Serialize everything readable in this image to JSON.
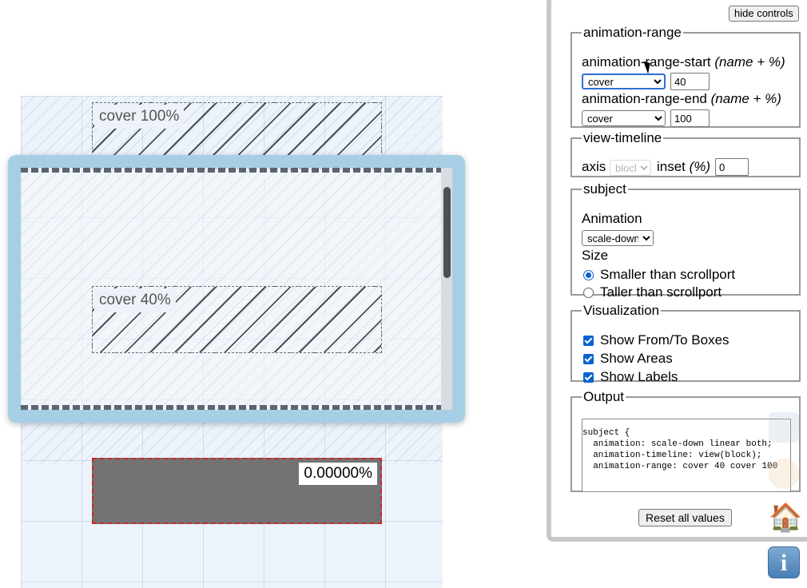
{
  "visualization": {
    "from_label": "cover 100%",
    "to_label": "cover 40%",
    "progress": "0.00000%"
  },
  "controls": {
    "hide_button": "hide controls",
    "animation_range": {
      "legend": "animation-range",
      "start_label": "animation-range-start",
      "start_hint": "(name + %)",
      "start_name": "cover",
      "start_value": "40",
      "end_label": "animation-range-end",
      "end_hint": "(name + %)",
      "end_name": "cover",
      "end_value": "100"
    },
    "view_timeline": {
      "legend": "view-timeline",
      "axis_label": "axis",
      "axis_value": "block",
      "inset_label": "inset",
      "inset_unit": "(%)",
      "inset_value": "0"
    },
    "subject": {
      "legend": "subject",
      "animation_label": "Animation",
      "animation_value": "scale-down",
      "size_label": "Size",
      "size_options": [
        "Smaller than scrollport",
        "Taller than scrollport"
      ],
      "size_selected": "Smaller than scrollport"
    },
    "visualization_opts": {
      "legend": "Visualization",
      "options": [
        "Show From/To Boxes",
        "Show Areas",
        "Show Labels"
      ],
      "checked": [
        true,
        true,
        true
      ]
    },
    "output": {
      "legend": "Output",
      "code": "subject {\n  animation: scale-down linear both;\n  animation-timeline: view(block);\n  animation-range: cover 40 cover 100"
    },
    "reset_button": "Reset all values"
  },
  "icons": {
    "home": "home-icon",
    "info": "info-icon",
    "info_glyph": "i",
    "home_glyph": "🏠"
  },
  "colors": {
    "scroller_border": "#a6cfe5",
    "subject_fill": "#737373",
    "subject_border": "#cc2a2a",
    "accent": "#0a62d0"
  }
}
